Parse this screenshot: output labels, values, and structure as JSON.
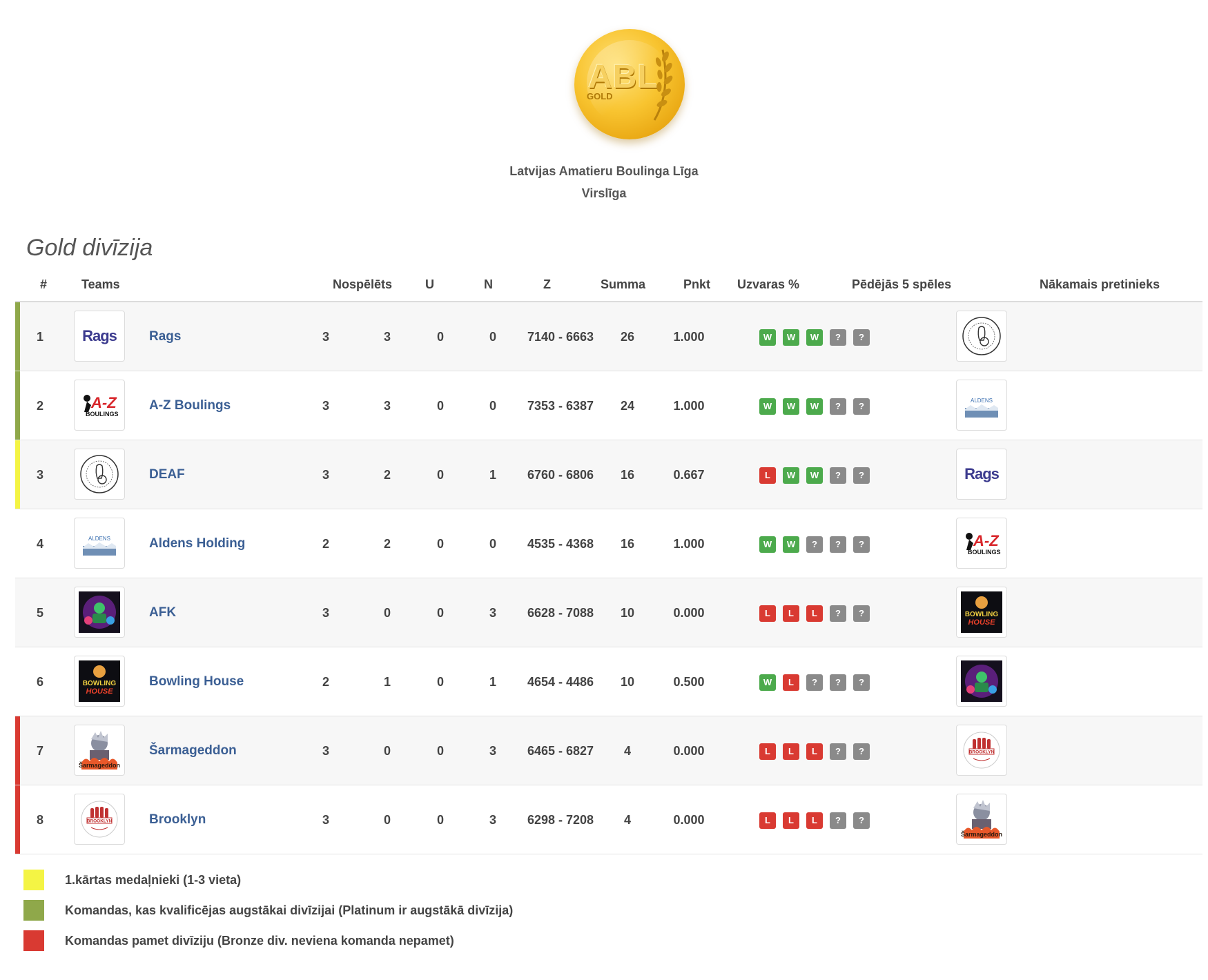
{
  "header": {
    "logo_text": "ABL",
    "logo_sub": "GOLD",
    "league_name": "Latvijas Amatieru Boulinga Līga",
    "league_sub": "Virslīga"
  },
  "division_title": "Gold divīzija",
  "columns": {
    "rank": "#",
    "teams": "Teams",
    "played": "Nospēlēts",
    "wins": "U",
    "draws": "N",
    "losses": "Z",
    "sum": "Summa",
    "points": "Pnkt",
    "win_pct": "Uzvaras %",
    "last5": "Pēdējās 5 spēles",
    "next": "Nākamais pretinieks"
  },
  "colors": {
    "green_marker": "#8fa84a",
    "yellow_marker": "#f4f444",
    "red_marker": "#d93a32",
    "win": "#4caa4c",
    "loss": "#d93a32",
    "unknown": "#8a8a8a",
    "link": "#3b5f94"
  },
  "rows": [
    {
      "rank": "1",
      "team": "Rags",
      "logo": "rags-logo",
      "played": "3",
      "wins": "3",
      "draws": "0",
      "losses": "0",
      "sum": "7140 - 6663",
      "points": "26",
      "win_pct": "1.000",
      "form": [
        "W",
        "W",
        "W",
        "?",
        "?"
      ],
      "marker": "green",
      "next_logo": "deaf-logo"
    },
    {
      "rank": "2",
      "team": "A-Z Boulings",
      "logo": "az-logo",
      "played": "3",
      "wins": "3",
      "draws": "0",
      "losses": "0",
      "sum": "7353 - 6387",
      "points": "24",
      "win_pct": "1.000",
      "form": [
        "W",
        "W",
        "W",
        "?",
        "?"
      ],
      "marker": "green",
      "next_logo": "aldens-logo"
    },
    {
      "rank": "3",
      "team": "DEAF",
      "logo": "deaf-logo",
      "played": "3",
      "wins": "2",
      "draws": "0",
      "losses": "1",
      "sum": "6760 - 6806",
      "points": "16",
      "win_pct": "0.667",
      "form": [
        "L",
        "W",
        "W",
        "?",
        "?"
      ],
      "marker": "yellow",
      "next_logo": "rags-logo"
    },
    {
      "rank": "4",
      "team": "Aldens Holding",
      "logo": "aldens-logo",
      "played": "2",
      "wins": "2",
      "draws": "0",
      "losses": "0",
      "sum": "4535 - 4368",
      "points": "16",
      "win_pct": "1.000",
      "form": [
        "W",
        "W",
        "?",
        "?",
        "?"
      ],
      "marker": "none",
      "next_logo": "az-logo"
    },
    {
      "rank": "5",
      "team": "AFK",
      "logo": "afk-logo",
      "played": "3",
      "wins": "0",
      "draws": "0",
      "losses": "3",
      "sum": "6628 - 7088",
      "points": "10",
      "win_pct": "0.000",
      "form": [
        "L",
        "L",
        "L",
        "?",
        "?"
      ],
      "marker": "none",
      "next_logo": "bowling-house-logo"
    },
    {
      "rank": "6",
      "team": "Bowling House",
      "logo": "bowling-house-logo",
      "played": "2",
      "wins": "1",
      "draws": "0",
      "losses": "1",
      "sum": "4654 - 4486",
      "points": "10",
      "win_pct": "0.500",
      "form": [
        "W",
        "L",
        "?",
        "?",
        "?"
      ],
      "marker": "none",
      "next_logo": "afk-logo"
    },
    {
      "rank": "7",
      "team": "Šarmageddon",
      "logo": "sarmageddon-logo",
      "played": "3",
      "wins": "0",
      "draws": "0",
      "losses": "3",
      "sum": "6465 - 6827",
      "points": "4",
      "win_pct": "0.000",
      "form": [
        "L",
        "L",
        "L",
        "?",
        "?"
      ],
      "marker": "red",
      "next_logo": "brooklyn-logo"
    },
    {
      "rank": "8",
      "team": "Brooklyn",
      "logo": "brooklyn-logo",
      "played": "3",
      "wins": "0",
      "draws": "0",
      "losses": "3",
      "sum": "6298 - 7208",
      "points": "4",
      "win_pct": "0.000",
      "form": [
        "L",
        "L",
        "L",
        "?",
        "?"
      ],
      "marker": "red",
      "next_logo": "sarmageddon-logo"
    }
  ],
  "logo_texts": {
    "rags": "Rags",
    "az": "A-Z",
    "az_sub": "BOULINGS",
    "aldens": "ALDENS",
    "bowling_house": "BOWLING HOUSE",
    "sarmageddon": "Šarmageddon",
    "brooklyn": "BROOKLYN"
  },
  "legend": [
    {
      "color": "#f4f444",
      "text": "1.kārtas medaļnieki (1-3 vieta)"
    },
    {
      "color": "#8fa84a",
      "text": "Komandas, kas kvalificējas augstākai divīzijai (Platinum ir augstākā divīzija)"
    },
    {
      "color": "#d93a32",
      "text": "Komandas pamet divīziju (Bronze div. neviena komanda nepamet)"
    }
  ]
}
